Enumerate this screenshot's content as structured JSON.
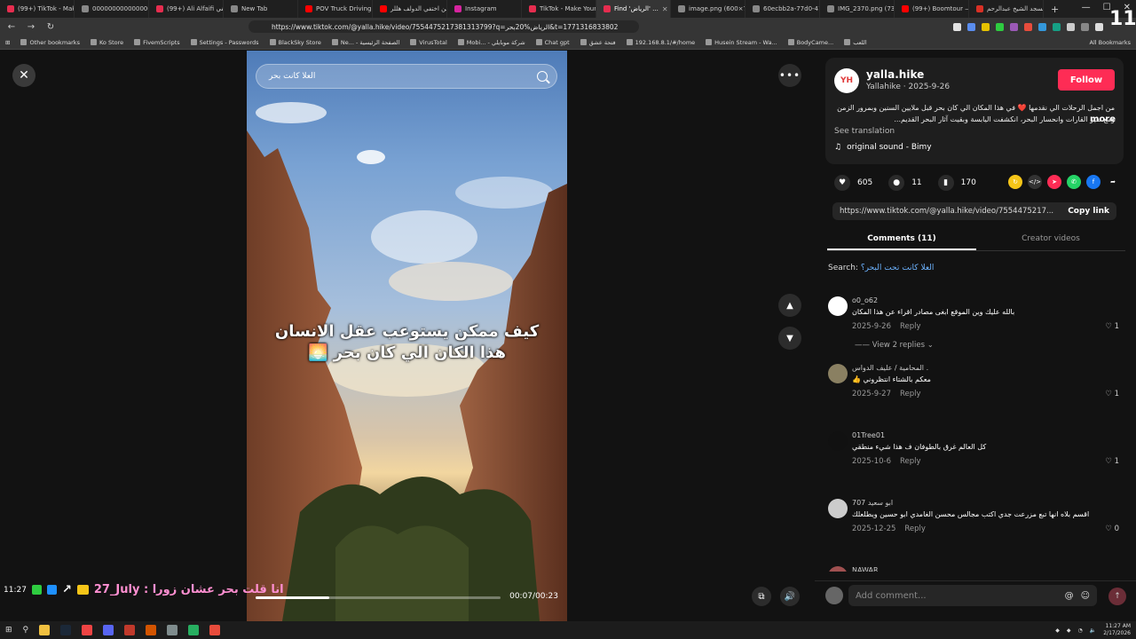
{
  "browser": {
    "tabs": [
      {
        "label": "(99+) TikTok - Make Yo",
        "color": "#e62d4f"
      },
      {
        "label": "00000000000000000",
        "color": "#888888"
      },
      {
        "label": "(99+) Ali Alfaifi العيفي",
        "color": "#e62d4f"
      },
      {
        "label": "New Tab",
        "color": "#888888"
      },
      {
        "label": "POV Truck Driving 🚚",
        "color": "#ff0000"
      },
      {
        "label": "ابن اختفي الدولف هللر",
        "color": "#ff0000"
      },
      {
        "label": "Instagram",
        "color": "#d6249f"
      },
      {
        "label": "TikTok - Make Your D",
        "color": "#e62d4f"
      },
      {
        "label": "Find 'الرياض' ...",
        "color": "#e62d4f",
        "active": true
      },
      {
        "label": "image.png (600×791)",
        "color": "#888888"
      },
      {
        "label": "60ecbb2a-77d0-416d",
        "color": "#888888"
      },
      {
        "label": "IMG_2370.png (736×",
        "color": "#888888"
      },
      {
        "label": "(99+) Boomtour — 群",
        "color": "#ff0000"
      },
      {
        "label": "مسجد الشيخ عبدالرحم",
        "color": "#d93025"
      }
    ],
    "tab_close": "✕",
    "new_tab": "+",
    "url": "https://www.tiktok.com/@yalla.hike/video/7554475217381313799?q=الرياض%20بحر&t=1771316833802",
    "bookmarks": [
      "Other bookmarks",
      "Ko Store",
      "FivemScripts",
      "Settings - Passwords",
      "BlackSky Store",
      "Ne... - الصفحة الرئيسية",
      "VirusTotal",
      "Mobi... - شركة موبايلي",
      "Chat gpt",
      "فتحة عشق",
      "192.168.8.1/#/home",
      "Husein Stream - Wa...",
      "BodyCame...",
      "اللعب"
    ],
    "all_bookmarks": "All Bookmarks"
  },
  "video": {
    "search_placeholder": "العلا كانت بحر",
    "caption_line1": "كيف ممكن يستوعب عقل الانسان",
    "caption_line2": "هذا الكان الي كان بحر 🌅",
    "time": "00:07/00:23",
    "progress": 0.3,
    "close_icon": "✕",
    "more_icon": "•••"
  },
  "stream_overlay": {
    "time": "11:27",
    "text": "27_July : انا قلت بحر عشان زورا"
  },
  "post": {
    "avatar_text": "YH",
    "username": "yalla.hike",
    "handle": "Yallahike",
    "date": "2025-9-26",
    "follow_label": "Follow",
    "description": "من اجمل الرحلات الي نقدمها ❤️ في هذا المكان الي كان بحر قبل ملايين السنين وبمرور الزمن ومع تغير القارات وانحسار البحر، انكشفت اليابسة وبقيت آثار البحر القديم...",
    "more_label": "more",
    "see_translation": "See translation",
    "sound": "original sound - Bimy",
    "likes": "605",
    "comments_count": "11",
    "saves": "170",
    "link": "https://www.tiktok.com/@yalla.hike/video/7554475217...",
    "copy_link": "Copy link",
    "tab_comments": "Comments (11)",
    "tab_creator": "Creator videos",
    "search_label": "Search:",
    "search_query": "العلا كانت تحت البحر؟"
  },
  "comments": [
    {
      "user": "o0_o62",
      "text": "بالله عليك وين الموقع ابغى مصادر اقراء عن هذا المكان",
      "date": "2025-9-26",
      "reply": "Reply",
      "likes": "1",
      "replies": "View 2 replies",
      "avatar_color": "#ffffff"
    },
    {
      "user": "المحامية / عليف الدواس .",
      "text": "معكم بالشتاء انتظروني 👍",
      "date": "2025-9-27",
      "reply": "Reply",
      "likes": "1",
      "replies": "",
      "avatar_color": "#8a8062"
    },
    {
      "user": "01Tree01",
      "text": "كل العالم غرق بالطوفان ف هذا شيء منطقي",
      "date": "2025-10-6",
      "reply": "Reply",
      "likes": "1",
      "replies": "",
      "avatar_color": "#111111"
    },
    {
      "user": "ابو سعيد 707",
      "text": "اقسم بلاه انها تبع مزرعت جدي اكتب مجالس محسن الغامدي ابو حسين ويطلعلك",
      "date": "2025-12-25",
      "reply": "Reply",
      "likes": "0",
      "replies": "",
      "avatar_color": "#cccccc"
    },
    {
      "user": "NAWAR",
      "text": "",
      "date": "",
      "reply": "",
      "likes": "",
      "replies": "",
      "avatar_color": "#a05050"
    }
  ],
  "add_comment": {
    "placeholder": "Add comment...",
    "at_icon": "@",
    "emoji_icon": "☺"
  },
  "taskbar": {
    "time": "11:27 AM",
    "date": "2/17/2026"
  },
  "colors": {
    "accent": "#fe2c55",
    "background": "#121212"
  }
}
